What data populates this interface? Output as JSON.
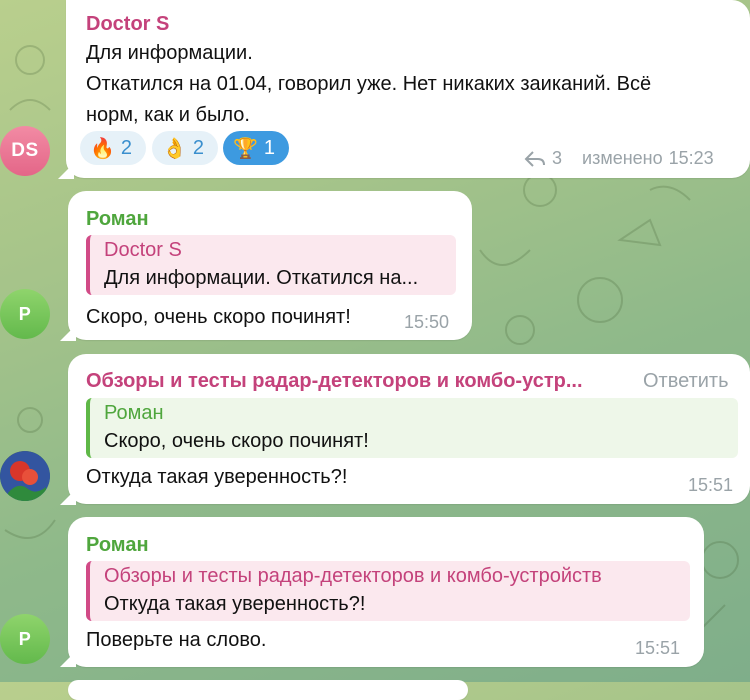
{
  "messages": [
    {
      "sender": "Doctor S",
      "avatar_initials": "DS",
      "text_lines": [
        "Для информации.",
        "Откатился на 01.04, говорил уже. Нет никаких заиканий. Всё",
        "норм, как и было."
      ],
      "reactions": [
        {
          "emoji": "🔥",
          "count": "2",
          "icon": "fire-icon"
        },
        {
          "emoji": "👌",
          "count": "2",
          "icon": "ok-hand-icon"
        },
        {
          "emoji": "🏆",
          "count": "1",
          "icon": "trophy-icon",
          "active": true
        }
      ],
      "replies_count": "3",
      "edited_label": "изменено",
      "time": "15:23"
    },
    {
      "sender": "Роман",
      "avatar_initials": "Р",
      "quote": {
        "name": "Doctor S",
        "text": "Для информации. Откатился на..."
      },
      "text": "Скоро, очень скоро починят!",
      "time": "15:50"
    },
    {
      "sender": "Обзоры и тесты радар-детекторов и комбо-устр...",
      "reply_label": "Ответить",
      "quote": {
        "name": "Роман",
        "text": "Скоро, очень скоро починят!"
      },
      "text": "Откуда такая уверенность?!",
      "time": "15:51"
    },
    {
      "sender": "Роман",
      "avatar_initials": "Р",
      "quote": {
        "name": "Обзоры и тесты радар-детекторов и комбо-устройств",
        "text": "Откуда такая уверенность?!"
      },
      "text": "Поверьте на слово.",
      "time": "15:51"
    }
  ],
  "colors": {
    "pink_name": "#c4427b",
    "green_name": "#4fa63d",
    "reaction_active": "#3d9ae0",
    "reaction_bg": "#e6f1f8"
  }
}
